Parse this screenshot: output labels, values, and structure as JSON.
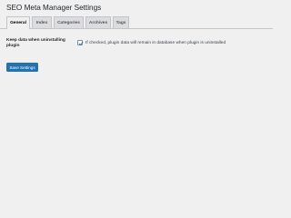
{
  "page": {
    "title": "SEO Meta Manager Settings"
  },
  "tabs": [
    {
      "label": "General",
      "active": true
    },
    {
      "label": "Index",
      "active": false
    },
    {
      "label": "Categories",
      "active": false
    },
    {
      "label": "Archives",
      "active": false
    },
    {
      "label": "Tags",
      "active": false
    }
  ],
  "settings": {
    "keep_data_label": "Keep data when uninstalling plugin",
    "keep_data_checked": true,
    "keep_data_description": "If checked, plugin data will remain in database when plugin is uninstalled"
  },
  "actions": {
    "save_label": "Save Settings"
  },
  "colors": {
    "background": "#f0f0f1",
    "accent": "#2271b1",
    "tab_inactive": "#dcdcde",
    "border": "#c3c4c7"
  },
  "icons": {
    "checkmark": "checkmark-icon"
  }
}
